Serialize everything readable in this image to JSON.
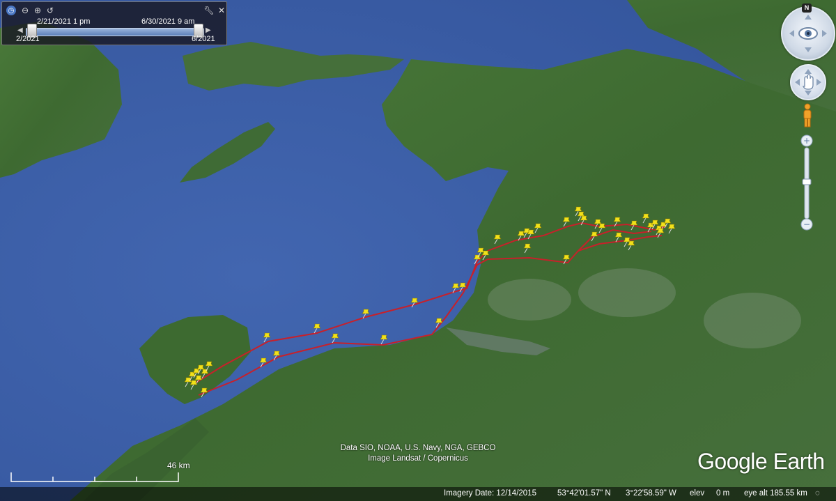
{
  "time_slider": {
    "start_time": "2/21/2021  1 pm",
    "end_time": "6/30/2021  9 am",
    "range_start": "2/2021",
    "range_end": "6/2021",
    "icons": [
      "clock-icon",
      "zoom-out-icon",
      "zoom-in-icon",
      "history-icon",
      "wrench-icon",
      "close-icon"
    ]
  },
  "navigation": {
    "compass_label": "N",
    "icons": [
      "look-icon",
      "move-icon",
      "pegman-icon",
      "zoom-plus-icon",
      "zoom-minus-icon"
    ]
  },
  "scale": {
    "label": "46 km"
  },
  "attribution": {
    "line1": "Data SIO, NOAA, U.S. Navy, NGA, GEBCO",
    "line2": "Image Landsat / Copernicus"
  },
  "logo": "Google Earth",
  "status": {
    "imagery_date": "Imagery Date: 12/14/2015",
    "latitude": "53°42'01.57\" N",
    "longitude": "3°22'58.59\" W",
    "elev_label": "elev",
    "elev_value": "0 m",
    "eye_alt": "eye alt 185.55 km"
  },
  "colors": {
    "sea": "#3b5fa8",
    "land": "#3f6b35",
    "track": "#c8202a",
    "placemark": "#f2e21a"
  },
  "placemark_icon": "yellow-pushpin-icon"
}
